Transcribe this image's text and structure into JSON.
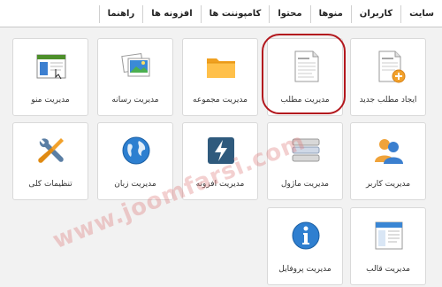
{
  "menu": {
    "items": [
      "سایت",
      "کاربران",
      "منوها",
      "محتوا",
      "کامپوننت ها",
      "افزونه ها",
      "راهنما"
    ]
  },
  "tiles": [
    {
      "id": "new-article",
      "label": "ایجاد مطلب جدید",
      "icon": "new-article-icon"
    },
    {
      "id": "article-manager",
      "label": "مدیریت مطلب",
      "icon": "article-document-icon"
    },
    {
      "id": "category-manager",
      "label": "مدیریت مجموعه",
      "icon": "folder-icon"
    },
    {
      "id": "media-manager",
      "label": "مدیریت رسانه",
      "icon": "media-photos-icon"
    },
    {
      "id": "menu-manager",
      "label": "مدیریت منو",
      "icon": "menu-window-icon"
    },
    {
      "id": "user-manager",
      "label": "مدیریت کاربر",
      "icon": "users-icon"
    },
    {
      "id": "module-manager",
      "label": "مدیریت ماژول",
      "icon": "module-stack-icon"
    },
    {
      "id": "extension-manager",
      "label": "مدیریت افزونه",
      "icon": "extension-bolt-icon"
    },
    {
      "id": "language-manager",
      "label": "مدیریت زبان",
      "icon": "globe-icon"
    },
    {
      "id": "global-configuration",
      "label": "تنظیمات کلی",
      "icon": "tools-icon"
    },
    {
      "id": "template-manager",
      "label": "مدیریت قالب",
      "icon": "template-icon"
    },
    {
      "id": "profile",
      "label": "مدیریت پروفایل",
      "icon": "info-icon"
    }
  ],
  "watermark": "www.joomfarsi.com",
  "colors": {
    "highlight": "#b3181e",
    "panel": "#f2f2f2"
  }
}
